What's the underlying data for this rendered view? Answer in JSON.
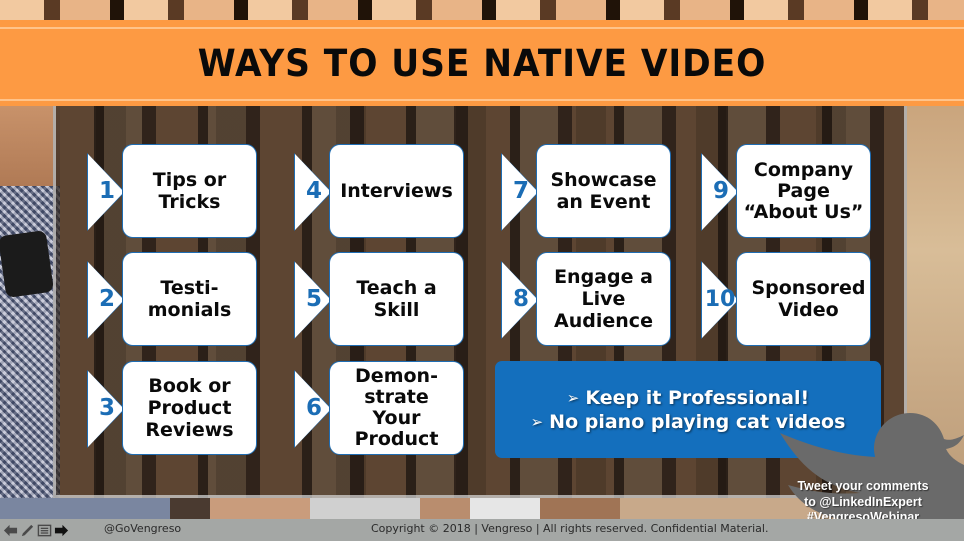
{
  "slide": {
    "title": "WAYS TO USE NATIVE VIDEO",
    "items": [
      {
        "number": "1",
        "label": "Tips or\nTricks"
      },
      {
        "number": "2",
        "label": "Testi-\nmonials"
      },
      {
        "number": "3",
        "label": "Book or\nProduct\nReviews"
      },
      {
        "number": "4",
        "label": "Interviews"
      },
      {
        "number": "5",
        "label": "Teach a\nSkill"
      },
      {
        "number": "6",
        "label": "Demon-\nstrate\nYour\nProduct"
      },
      {
        "number": "7",
        "label": "Showcase\nan Event"
      },
      {
        "number": "8",
        "label": "Engage a\nLive\nAudience"
      },
      {
        "number": "9",
        "label": "Company\nPage\n“About Us”"
      },
      {
        "number": "10",
        "label": "Sponsored\nVideo"
      }
    ],
    "tips": {
      "bullet": "➢",
      "lines": [
        "Keep it Professional!",
        "No piano playing cat videos"
      ]
    },
    "twitter": {
      "lines": [
        "Tweet your comments",
        "to @LinkedInExpert",
        "#VengresoWebinar"
      ]
    }
  },
  "footer": {
    "handle": "@GoVengreso",
    "copyright": "Copyright © 2018 | Vengreso | All rights reserved. Confidential Material.",
    "controls": [
      "previous-slide",
      "pen-tool",
      "slide-menu",
      "next-slide"
    ]
  },
  "colors": {
    "header_orange": "#fd9a43",
    "number_blue": "#1b6db5",
    "tipbox_blue": "#146fbd",
    "bird_grey": "#6a6a6a",
    "footer_grey": "#a4a7a5"
  }
}
